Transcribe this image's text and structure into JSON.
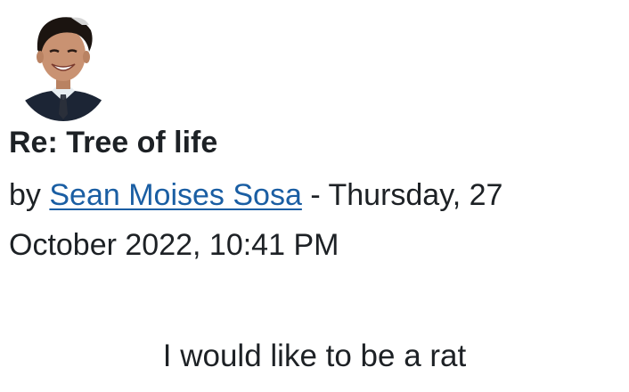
{
  "post": {
    "subject": "Re: Tree of life",
    "by_prefix": "by",
    "author": "Sean Moises Sosa",
    "separator": " - ",
    "date_part1": "Thursday, 27",
    "date_part2": "October 2022, 10:41 PM",
    "message": "I would like to be a rat"
  },
  "colors": {
    "link": "#1a5ea3",
    "text": "#1d2125"
  },
  "icons": {
    "avatar": "user-profile-photo"
  }
}
